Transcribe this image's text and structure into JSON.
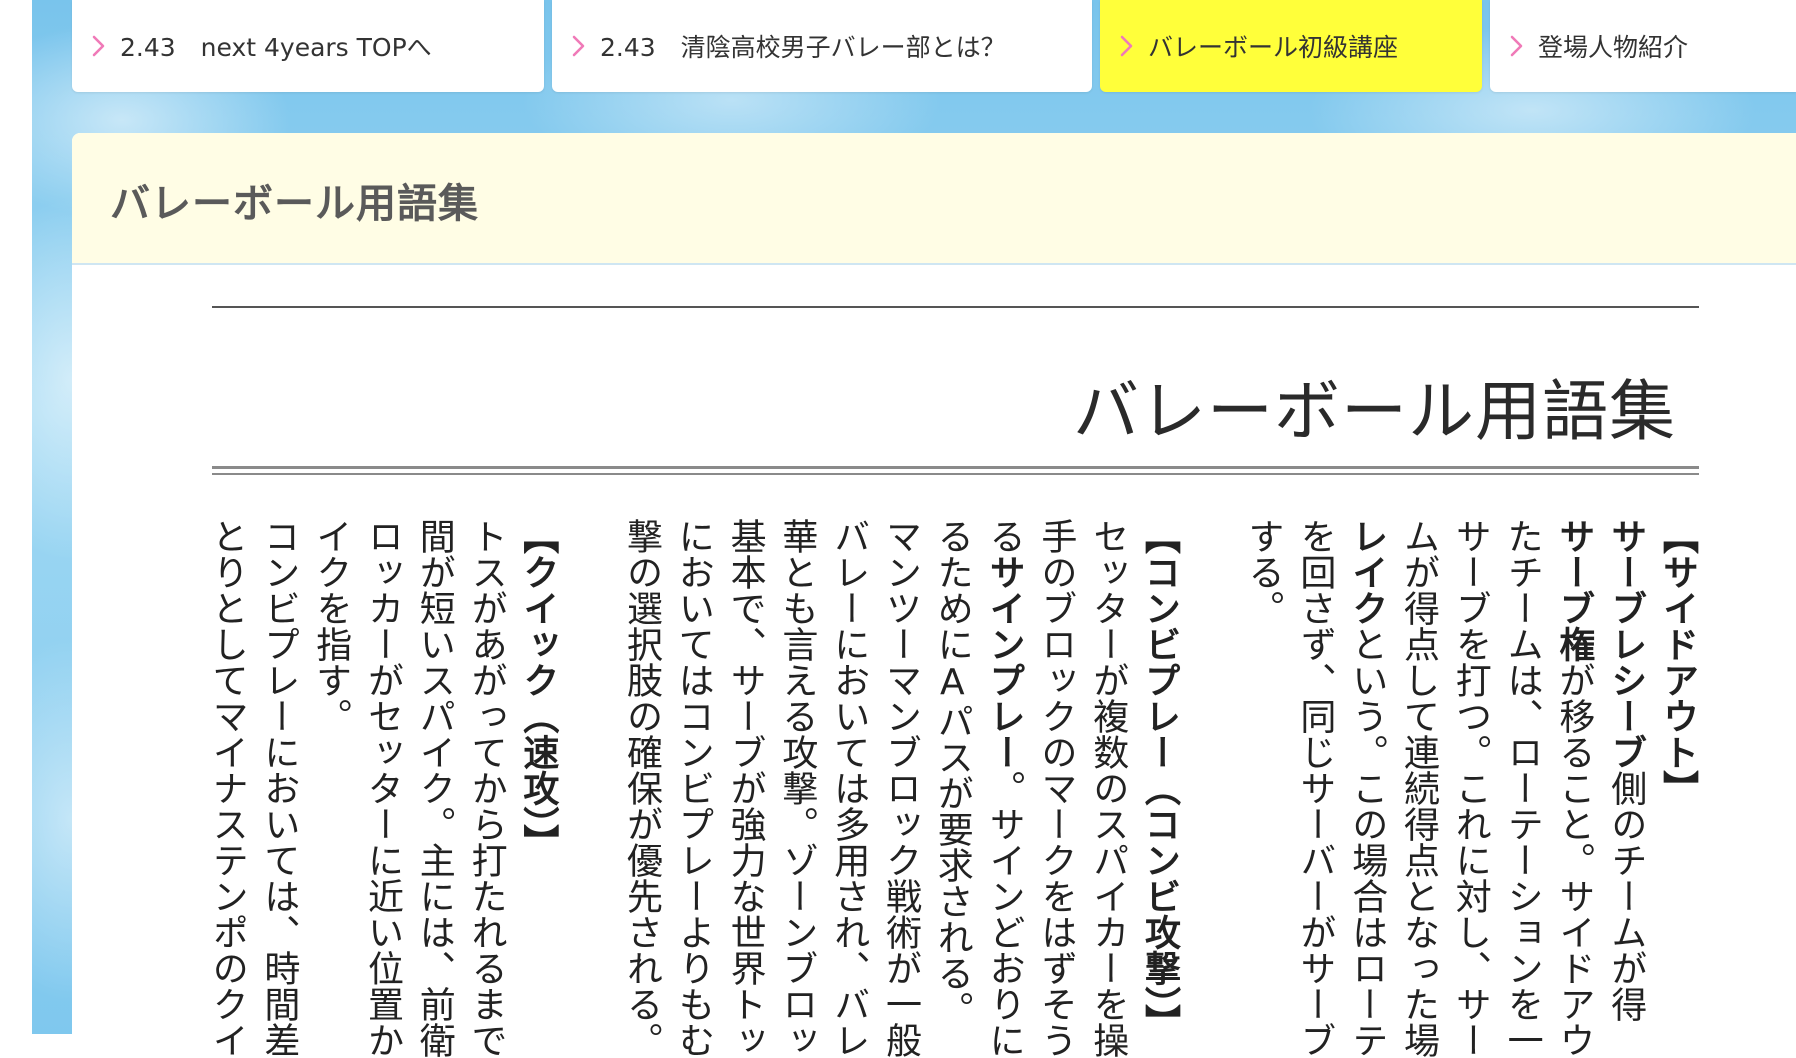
{
  "nav": {
    "tabs": [
      {
        "label": "2.43　next 4years TOPへ",
        "active": false
      },
      {
        "label": "2.43　清陰高校男子バレー部とは？",
        "active": false
      },
      {
        "label": "バレーボール初級講座",
        "active": true
      },
      {
        "label": "登場人物紹介",
        "active": false
      }
    ]
  },
  "page": {
    "title": "バレーボール用語集"
  },
  "article": {
    "heading": "バレーボール用語集",
    "columns": [
      [
        {
          "t": "【サイドアウト】",
          "b": true
        }
      ],
      [
        {
          "t": "サーブレシーブ",
          "b": true
        },
        {
          "t": "側のチームが得"
        }
      ],
      [
        {
          "t": "サーブ権",
          "b": true
        },
        {
          "t": "が移ること。サイドアウ"
        }
      ],
      [
        {
          "t": "たチームは、ローテーションを一つ"
        }
      ],
      [
        {
          "t": "サーブを打つ。これに対し、サーブ"
        }
      ],
      [
        {
          "t": "ムが得点して連続得点となった場"
        }
      ],
      [
        {
          "t": "レイク",
          "b": true
        },
        {
          "t": "という。この場合はローテ"
        }
      ],
      [
        {
          "t": "を回さず、同じサーバーがサーブ"
        }
      ],
      [
        {
          "t": "する。"
        }
      ],
      [
        {
          "t": ""
        }
      ],
      [
        {
          "t": "【コンビプレー（コンビ攻撃）】",
          "b": true
        }
      ],
      [
        {
          "t": "セッターが複数のスパイカーを操"
        }
      ],
      [
        {
          "t": "手のブロックのマークをはずそうと"
        }
      ],
      [
        {
          "t": "る"
        },
        {
          "t": "サインプレー",
          "b": true
        },
        {
          "t": "。サインどおりに"
        }
      ],
      [
        {
          "t": "るためにAパスが要求される。"
        }
      ],
      [
        {
          "t": "マンツーマンブロック戦術が一般的"
        }
      ],
      [
        {
          "t": "バレーにおいては多用され、バレー"
        }
      ],
      [
        {
          "t": "華とも言える攻撃。ゾーンブロック"
        }
      ],
      [
        {
          "t": "基本で、サーブが強力な世界トッ"
        }
      ],
      [
        {
          "t": "においてはコンビプレーよりもむし"
        }
      ],
      [
        {
          "t": "撃の選択肢の確保が優先される。"
        }
      ],
      [
        {
          "t": ""
        }
      ],
      [
        {
          "t": "【クイック（速攻）】",
          "b": true
        }
      ],
      [
        {
          "t": "トスがあがってから打たれるまでの"
        }
      ],
      [
        {
          "t": "間が短いスパイク。主には、前衛の"
        }
      ],
      [
        {
          "t": "ロッカーがセッターに近い位置から"
        }
      ],
      [
        {
          "t": "イクを指す。"
        }
      ],
      [
        {
          "t": "コンビプレーにおいては、時間差攻"
        }
      ],
      [
        {
          "t": "とりとしてマイナステンポのクイッ"
        }
      ]
    ]
  },
  "colors": {
    "active_tab": "#ffff3a",
    "tab_chevron": "#f07ab8",
    "panel_header": "#fffde5",
    "page_title": "#5a5a5a",
    "sky": "#79c4ec"
  },
  "icons": {
    "tab_chevron": "chevron-right-icon"
  }
}
